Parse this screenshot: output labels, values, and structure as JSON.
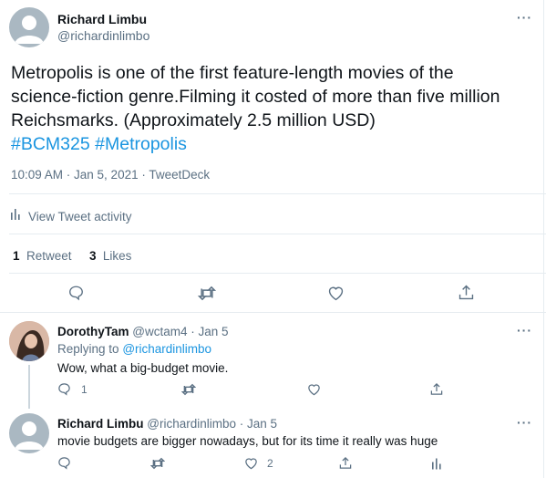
{
  "tweet": {
    "author_name": "Richard Limbu",
    "author_handle": "@richardinlimbo",
    "text_line1": "Metropolis is one of the first feature-length movies of the",
    "text_line2": "science-fiction genre.Filming it costed of more than five million",
    "text_line3": "Reichsmarks. (Approximately 2.5 million USD)",
    "hashtag1": "#BCM325",
    "hashtag2": "#Metropolis",
    "timestamp": "10:09 AM · Jan 5, 2021 · TweetDeck",
    "activity_label": "View Tweet activity",
    "retweet_count": "1",
    "retweet_label": "Retweet",
    "like_count": "3",
    "like_label": "Likes",
    "more": "···"
  },
  "replies": [
    {
      "name": "DorothyTam",
      "handle": "@wctam4",
      "date": "· Jan 5",
      "replying_prefix": "Replying to",
      "replying_to": "@richardinlimbo",
      "text": "Wow, what a big-budget movie.",
      "reply_count": "1",
      "more": "···"
    },
    {
      "name": "Richard Limbu",
      "handle": "@richardinlimbo",
      "date": "· Jan 5",
      "text": "movie budgets are bigger nowadays, but for its time it really was huge",
      "like_count": "2",
      "more": "···"
    }
  ],
  "icons": {
    "reply": "reply-icon",
    "retweet": "retweet-icon",
    "like": "heart-icon",
    "share": "share-icon",
    "activity": "bar-chart-icon",
    "more": "more-icon"
  },
  "colors": {
    "link": "#1b95e0",
    "muted": "#5b7083",
    "divider": "#e6ecf0",
    "text": "#0f1419"
  }
}
